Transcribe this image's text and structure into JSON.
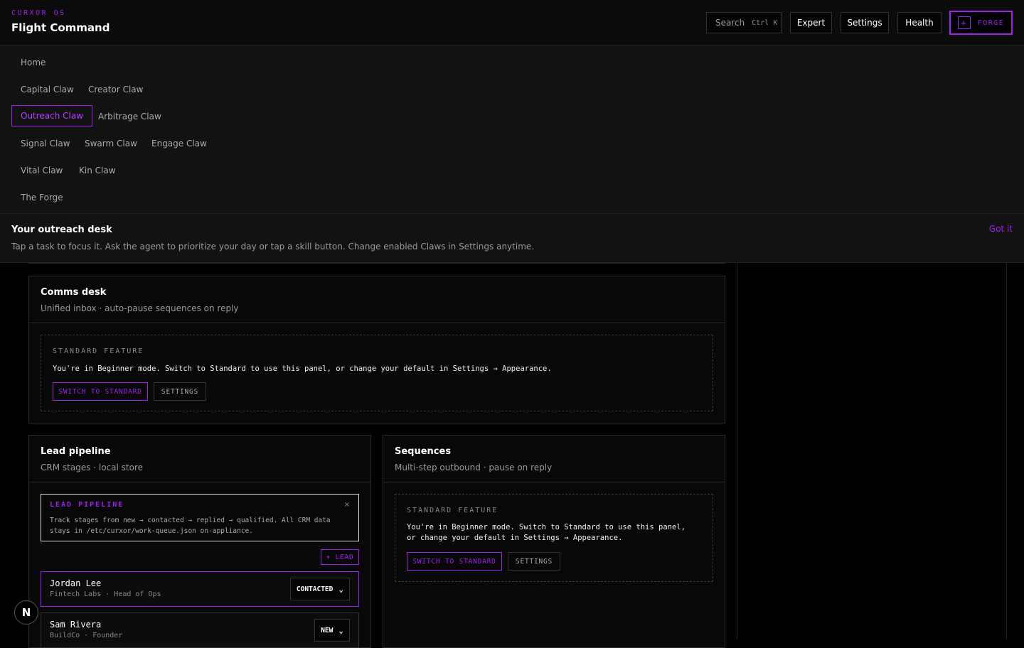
{
  "header": {
    "brand_small": "CURXOR OS",
    "title": "Flight Command",
    "search_label": "Search",
    "search_shortcut": "Ctrl K",
    "expert_label": "Expert",
    "settings_label": "Settings",
    "health_label": "Health",
    "forge_label": "FORGE",
    "forge_icon": "+"
  },
  "nav": {
    "items": [
      {
        "label": "Home"
      },
      {
        "label": "Capital Claw"
      },
      {
        "label": "Creator Claw"
      },
      {
        "label": "Outreach Claw",
        "active": true
      },
      {
        "label": "Arbitrage Claw"
      },
      {
        "label": "Signal Claw"
      },
      {
        "label": "Swarm Claw"
      },
      {
        "label": "Engage Claw"
      },
      {
        "label": "Vital Claw"
      },
      {
        "label": "Kin Claw"
      },
      {
        "label": "The Forge"
      }
    ]
  },
  "banner": {
    "title": "Your outreach desk",
    "text": "Tap a task to focus it. Ask the agent to prioritize your day or tap a skill button. Change enabled Claws in Settings anytime.",
    "dismiss": "Got it"
  },
  "comms": {
    "title": "Comms desk",
    "subtitle": "Unified inbox · auto-pause sequences on reply",
    "std_label": "STANDARD FEATURE",
    "std_text": "You're in Beginner mode. Switch to Standard to use this panel, or change your default in Settings → Appearance.",
    "switch_label": "SWITCH TO STANDARD",
    "settings_label": "SETTINGS"
  },
  "pipeline": {
    "title": "Lead pipeline",
    "subtitle": "CRM stages · local store",
    "info_label": "LEAD PIPELINE",
    "info_text": "Track stages from new → contacted → replied → qualified. All CRM data stays in /etc/curxor/work-queue.json on-appliance.",
    "info_close": "×",
    "add_label": "+ LEAD",
    "leads": [
      {
        "name": "Jordan Lee",
        "meta": "Fintech Labs · Head of Ops",
        "stage": "CONTACTED"
      },
      {
        "name": "Sam Rivera",
        "meta": "BuildCo · Founder",
        "stage": "NEW"
      }
    ]
  },
  "sequences": {
    "title": "Sequences",
    "subtitle": "Multi-step outbound · pause on reply",
    "std_label": "STANDARD FEATURE",
    "std_text": "You're in Beginner mode. Switch to Standard to use this panel, or change your default in Settings → Appearance.",
    "switch_label": "SWITCH TO STANDARD",
    "settings_label": "SETTINGS"
  },
  "fab": {
    "label": "N"
  },
  "colors": {
    "accent": "#a020f0",
    "background": "#000000",
    "surface": "#121212"
  }
}
